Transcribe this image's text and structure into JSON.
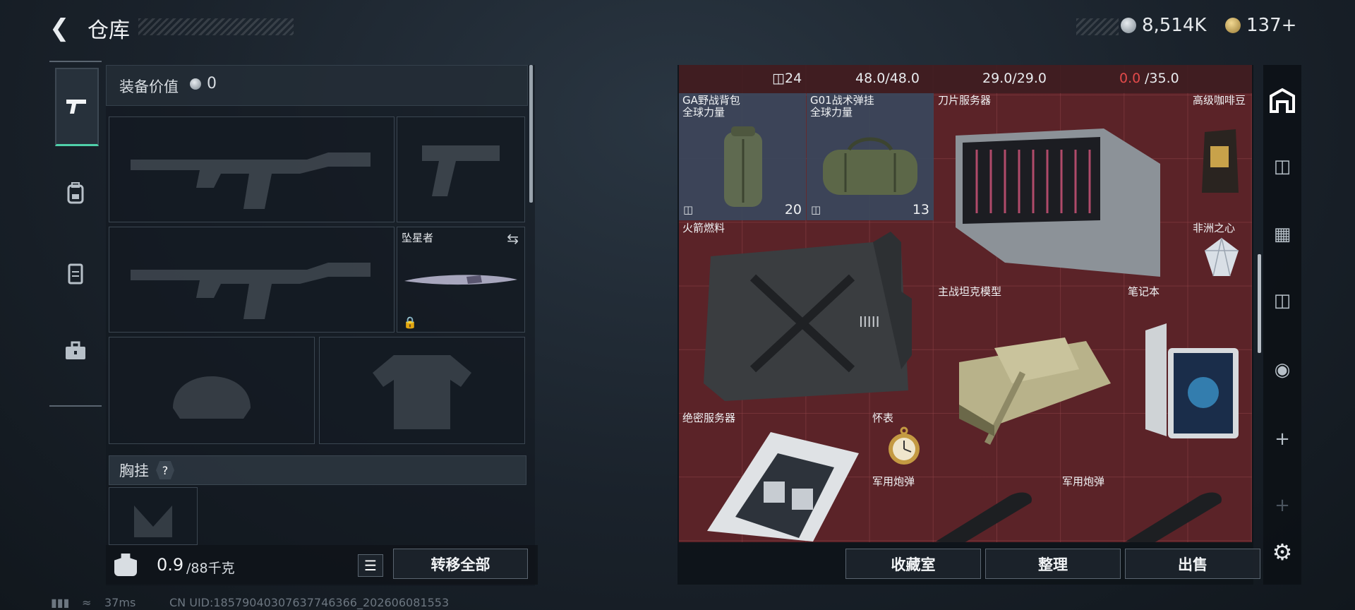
{
  "header": {
    "title": "仓库",
    "currency_silver": "8,514K",
    "currency_gold": "137+"
  },
  "left_tabs": [
    "weapons-tab",
    "backpack-tab",
    "vest-tab",
    "toolbox-tab"
  ],
  "equipment": {
    "value_label": "装备价值",
    "value": "0",
    "melee_slot_label": "坠星者",
    "chest_rig_label": "胸挂",
    "help": "?",
    "weight_current": "0.9",
    "weight_max": "/88千克",
    "transfer_all": "转移全部"
  },
  "stash": {
    "stats": [
      "24",
      "48.0/48.0",
      "29.0/29.0",
      "0.0",
      "/35.0"
    ],
    "items": [
      {
        "name": "GA野战背包\n全球力量",
        "count": "20"
      },
      {
        "name": "G01战术弹挂\n全球力量",
        "count": "13"
      },
      {
        "name": "刀片服务器"
      },
      {
        "name": "高级咖啡豆"
      },
      {
        "name": "火箭燃料"
      },
      {
        "name": "非洲之心"
      },
      {
        "name": "主战坦克模型"
      },
      {
        "name": "笔记本"
      },
      {
        "name": "绝密服务器"
      },
      {
        "name": "怀表"
      },
      {
        "name": "军用炮弹"
      },
      {
        "name": "军用炮弹"
      }
    ],
    "buttons": {
      "collection": "收藏室",
      "organize": "整理",
      "sell": "出售"
    }
  },
  "status_bar": {
    "ping": "37ms",
    "uid": "CN UID:18579040307637746366_202606081553"
  },
  "colors": {
    "grid_bg": "#5b2328",
    "accent_active": "#4fd0a9",
    "warn_red": "#e24a4a"
  }
}
